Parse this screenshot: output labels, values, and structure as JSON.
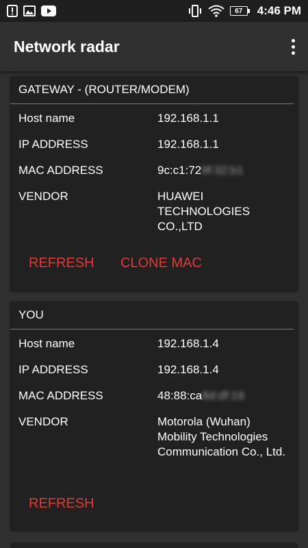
{
  "status_bar": {
    "time": "4:46 PM",
    "battery": "67",
    "left_icons": [
      "alert-icon",
      "image-icon",
      "youtube-icon"
    ],
    "right_icons": [
      "vibrate-icon",
      "wifi-icon",
      "battery-icon"
    ]
  },
  "app_bar": {
    "title": "Network radar",
    "menu_icon": "overflow-menu-icon"
  },
  "colors": {
    "accent": "#e53935",
    "card": "#212121",
    "background": "#303030"
  },
  "gateway": {
    "header": "GATEWAY - (ROUTER/MODEM)",
    "host_label": "Host name",
    "host_value": "192.168.1.1",
    "ip_label": "IP ADDRESS",
    "ip_value": "192.168.1.1",
    "mac_label": "MAC ADDRESS",
    "mac_value": "9c:c1:72",
    "mac_hidden": "9f:32:b1",
    "vendor_label": "VENDOR",
    "vendor_value": "HUAWEI TECHNOLOGIES CO.,LTD",
    "refresh": "REFRESH",
    "clone": "CLONE MAC"
  },
  "you": {
    "header": "YOU",
    "host_label": "Host name",
    "host_value": "192.168.1.4",
    "ip_label": "IP ADDRESS",
    "ip_value": "192.168.1.4",
    "mac_label": "MAC ADDRESS",
    "mac_value": "48:88:ca",
    "mac_hidden": "8d:df:19",
    "vendor_label": "VENDOR",
    "vendor_value": "Motorola (Wuhan) Mobility Technologies Communication Co., Ltd.",
    "refresh": "REFRESH"
  }
}
